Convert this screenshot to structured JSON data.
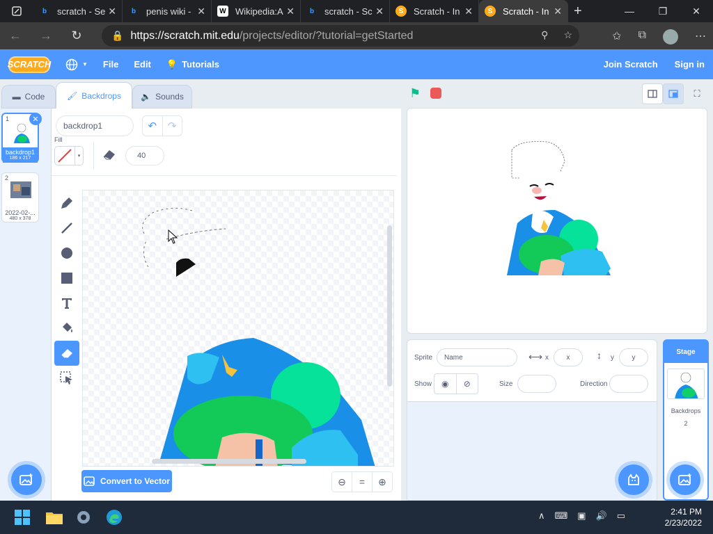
{
  "browser": {
    "tabs": [
      {
        "title": "scratch - Se",
        "favicon": "bing-icon",
        "active": false
      },
      {
        "title": "penis wiki -",
        "favicon": "bing-icon",
        "active": false
      },
      {
        "title": "Wikipedia:A",
        "favicon": "wikipedia-icon",
        "active": false
      },
      {
        "title": "scratch - Sc",
        "favicon": "bing-icon",
        "active": false
      },
      {
        "title": "Scratch - In",
        "favicon": "scratch-icon",
        "active": false
      },
      {
        "title": "Scratch - In",
        "favicon": "scratch-icon",
        "active": true
      }
    ],
    "new_tab": "+",
    "url_host": "https://scratch.mit.edu",
    "url_path": "/projects/editor/?tutorial=getStarted"
  },
  "scratch_menu": {
    "logo": "SCRATCH",
    "file": "File",
    "edit": "Edit",
    "tutorials": "Tutorials",
    "join": "Join Scratch",
    "signin": "Sign in"
  },
  "editor_tabs": {
    "code": "Code",
    "backdrops": "Backdrops",
    "sounds": "Sounds"
  },
  "backdrops": [
    {
      "num": "1",
      "name": "backdrop1",
      "size": "186 x 217"
    },
    {
      "num": "2",
      "name": "2022-02-...",
      "size": "480 x 378"
    }
  ],
  "paint": {
    "costume_name": "backdrop1",
    "fill_label": "Fill",
    "eraser_size": "40",
    "convert_label": "Convert to Vector",
    "zoom_reset": "="
  },
  "sprite_info": {
    "sprite_label": "Sprite",
    "name_placeholder": "Name",
    "x_label": "x",
    "x_placeholder": "x",
    "y_label": "y",
    "y_placeholder": "y",
    "show_label": "Show",
    "size_label": "Size",
    "direction_label": "Direction"
  },
  "stage_panel": {
    "header": "Stage",
    "backdrops_label": "Backdrops",
    "backdrops_count": "2"
  },
  "taskbar": {
    "time": "2:41 PM",
    "date": "2/23/2022"
  },
  "colors": {
    "scratch_blue": "#4d97ff",
    "accent": "#4c97ff",
    "flag_green": "#0fbd8c",
    "stop_red": "#ec5959"
  }
}
